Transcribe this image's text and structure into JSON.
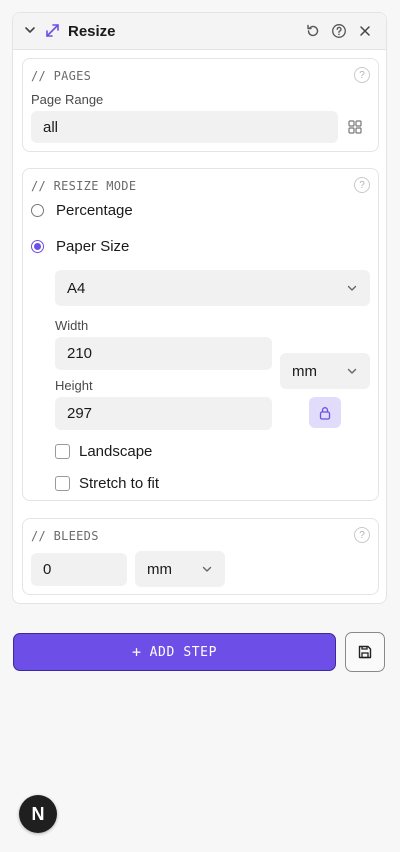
{
  "header": {
    "title": "Resize",
    "icons": [
      "chevron-down-icon",
      "resize-arrows-icon",
      "reset-icon",
      "help-icon",
      "close-icon"
    ],
    "accent": "#6d4ee6"
  },
  "pages": {
    "heading": "// PAGES",
    "label": "Page Range",
    "value": "all",
    "help": "?"
  },
  "resize_mode": {
    "heading": "// RESIZE MODE",
    "help": "?",
    "options": [
      {
        "label": "Percentage",
        "selected": false
      },
      {
        "label": "Paper Size",
        "selected": true
      }
    ],
    "paper_size": "A4",
    "width_label": "Width",
    "width_value": "210",
    "height_label": "Height",
    "height_value": "297",
    "unit": "mm",
    "landscape_label": "Landscape",
    "stretch_label": "Stretch to fit"
  },
  "bleeds": {
    "heading": "// BLEEDS",
    "help": "?",
    "value": "0",
    "unit": "mm"
  },
  "actions": {
    "add_step_label": "ADD STEP",
    "add_step_glyph": "+"
  },
  "badge": {
    "letter": "N"
  }
}
